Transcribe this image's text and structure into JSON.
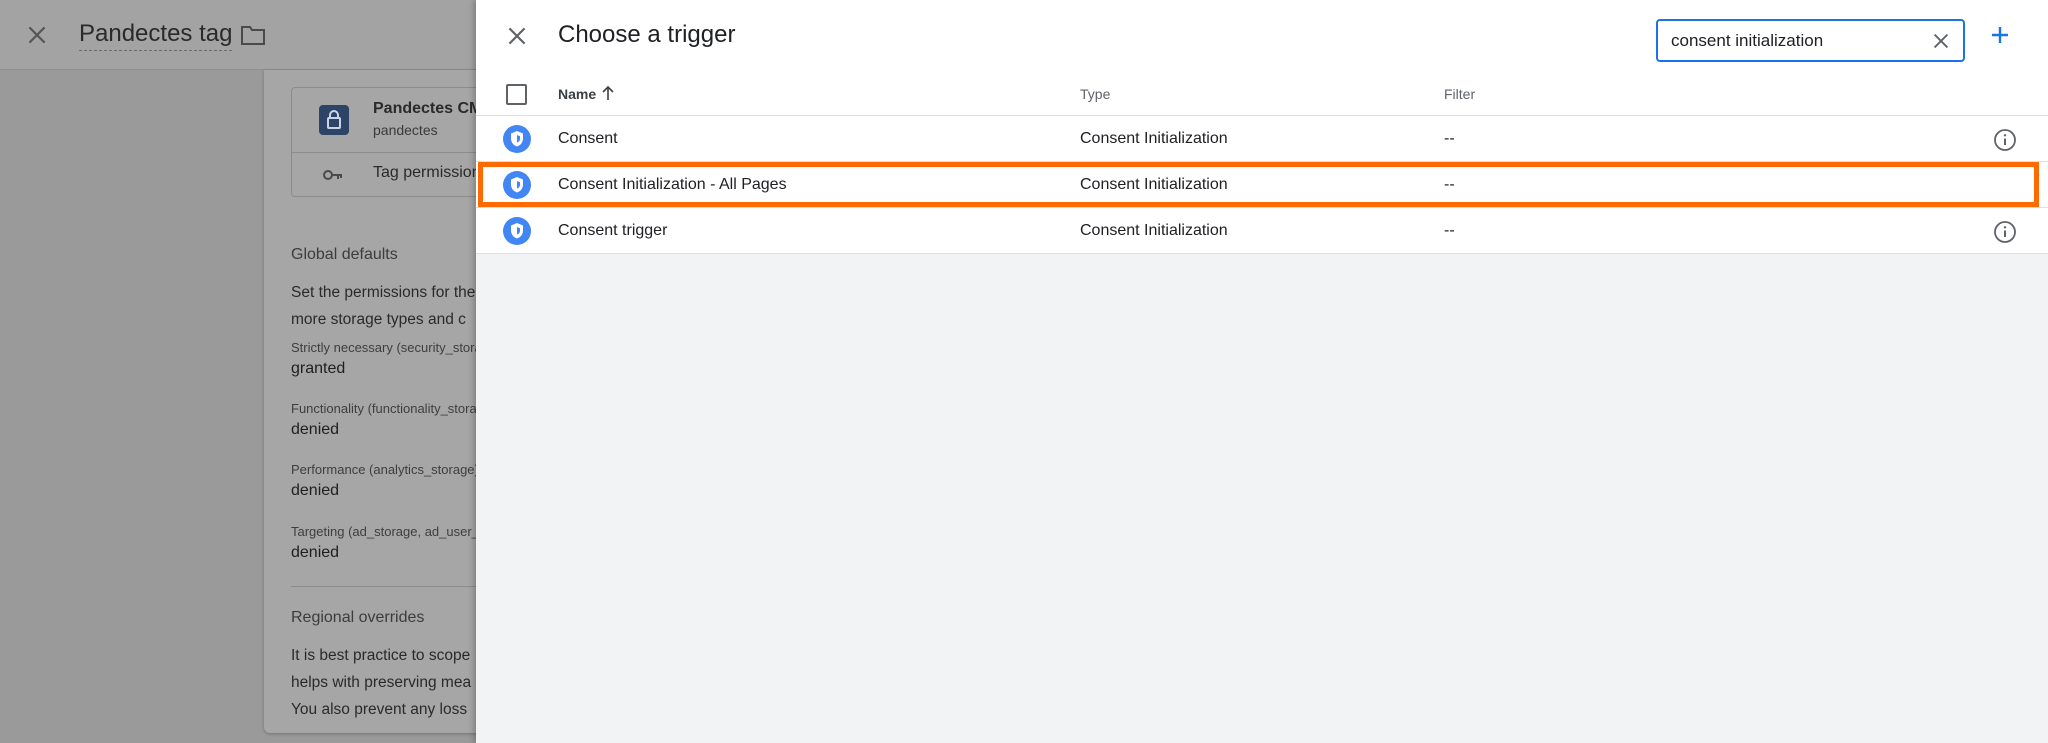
{
  "background": {
    "title": "Pandectes tag",
    "tag_name": "Pandectes CMP",
    "tag_vendor": "pandectes",
    "tag_permissions": "Tag permissions",
    "global_defaults_heading": "Global defaults",
    "global_defaults_text": [
      "Set the permissions for the",
      "more storage types and c"
    ],
    "defaults": [
      {
        "label": "Strictly necessary (security_storage)",
        "value": "granted"
      },
      {
        "label": "Functionality (functionality_storage)",
        "value": "denied"
      },
      {
        "label": "Performance (analytics_storage)",
        "value": "denied"
      },
      {
        "label": "Targeting (ad_storage, ad_user_data)",
        "value": "denied"
      }
    ],
    "regional_heading": "Regional overrides",
    "regional_text": [
      "It is best practice to scope",
      "helps with preserving mea",
      "You also prevent any loss"
    ]
  },
  "panel": {
    "title": "Choose a trigger",
    "search_value": "consent initialization",
    "columns": {
      "name": "Name",
      "type": "Type",
      "filter": "Filter"
    },
    "rows": [
      {
        "name": "Consent",
        "type": "Consent Initialization",
        "filter": "--"
      },
      {
        "name": "Consent Initialization - All Pages",
        "type": "Consent Initialization",
        "filter": "--"
      },
      {
        "name": "Consent trigger",
        "type": "Consent Initialization",
        "filter": "--"
      }
    ]
  },
  "colors": {
    "accent": "#1a73e8",
    "highlight": "#ff6a00",
    "trigger_icon": "#4285f4"
  }
}
